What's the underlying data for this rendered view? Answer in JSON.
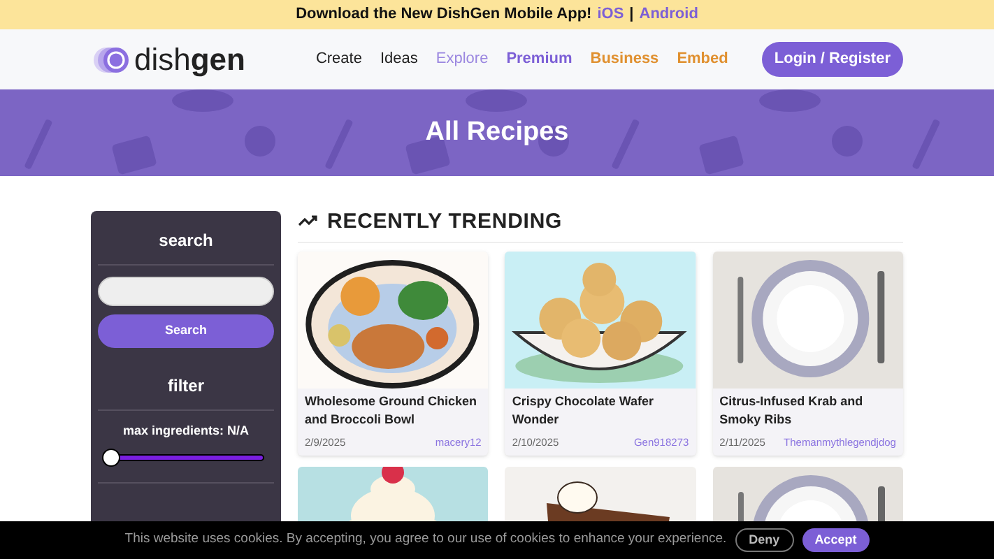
{
  "promo_banner": {
    "text": "Download the New DishGen Mobile App!",
    "links": [
      "iOS",
      "Android"
    ],
    "separator": "|"
  },
  "header": {
    "logo": "dish**gen**",
    "nav": [
      {
        "label": "Create",
        "color": "#222222",
        "bold": false
      },
      {
        "label": "Ideas",
        "color": "#222222",
        "bold": false
      },
      {
        "label": "Explore",
        "color": "#9b87e0",
        "bold": false
      },
      {
        "label": "Premium",
        "color": "#7c5fd6",
        "bold": true
      },
      {
        "label": "Business",
        "color": "#e0902f",
        "bold": true
      },
      {
        "label": "Embed",
        "color": "#e0902f",
        "bold": true
      }
    ],
    "login_button": "Login / Register"
  },
  "hero": {
    "title": "All Recipes"
  },
  "sidebar": {
    "search_heading": "search",
    "search_button": "Search",
    "filter_heading": "filter",
    "filter_label": "max ingredients: N/A",
    "slider": {
      "level": 0
    }
  },
  "section": {
    "title": "RECENTLY TRENDING"
  },
  "cards": [
    {
      "kind": "chicken",
      "title": "Wholesome Ground Chicken and Broccoli Bowl",
      "date": "2/9/2025",
      "author": "macery12"
    },
    {
      "kind": "cookies",
      "title": "Crispy Chocolate Wafer Wonder",
      "date": "2/10/2025",
      "author": "Gen918273"
    },
    {
      "kind": "plate",
      "title": "Citrus-Infused Krab and Smoky Ribs",
      "date": "2/11/2025",
      "author": "Themanmythlegendjdog"
    },
    {
      "kind": "cream"
    },
    {
      "kind": "pie"
    },
    {
      "kind": "plate"
    }
  ],
  "cookie_bar": {
    "text": "This website uses cookies. By accepting, you agree to our use of cookies to enhance your experience.",
    "deny_button": "Deny",
    "accept_button": "Accept"
  }
}
